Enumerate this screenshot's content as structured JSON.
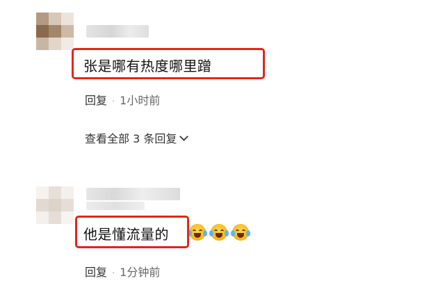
{
  "colors": {
    "highlight_border": "#e0261b",
    "text": "#111111",
    "meta_text": "#333333"
  },
  "comments": [
    {
      "text": "张是哪有热度哪里蹭",
      "reply_label": "回复",
      "separator": "·",
      "time": "1小时前",
      "view_replies": "查看全部 3 条回复"
    },
    {
      "text": "他是懂流量的",
      "emojis": [
        "laugh-cry-icon",
        "laugh-cry-icon",
        "laugh-cry-icon"
      ],
      "reply_label": "回复",
      "separator": "·",
      "time": "1分钟前"
    }
  ]
}
